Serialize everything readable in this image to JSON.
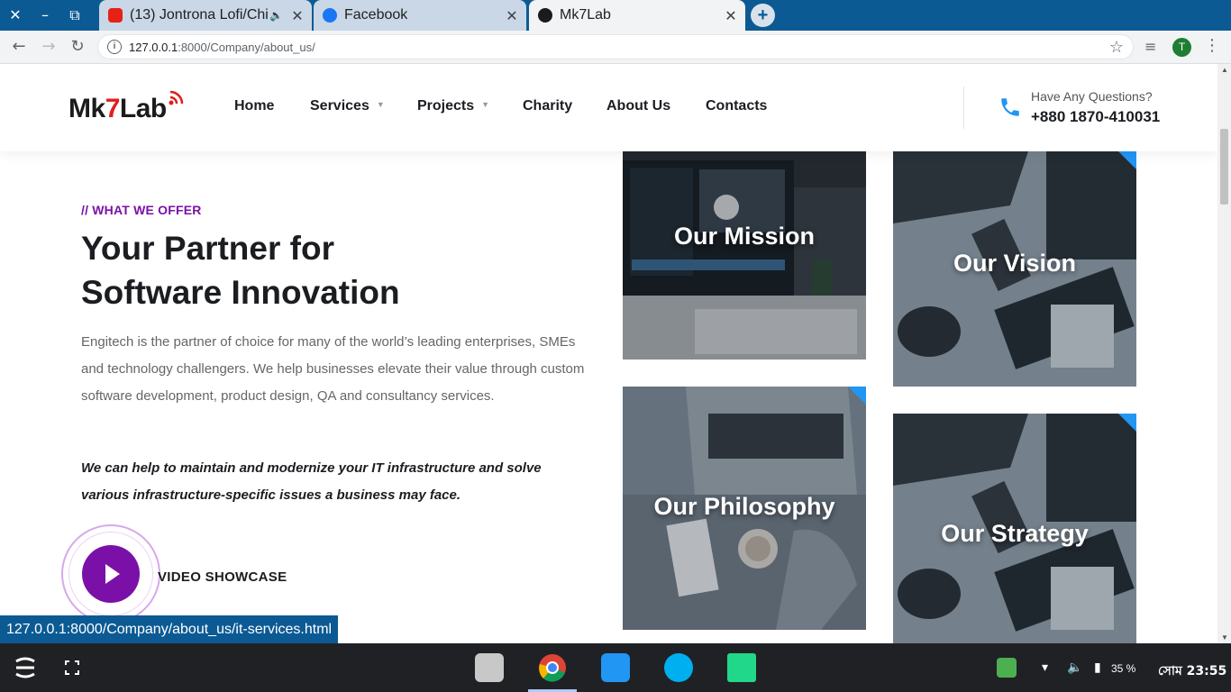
{
  "browser": {
    "tabs": [
      {
        "title": "(13) Jontrona Lofi/Chi",
        "favicon": "youtube-icon",
        "active": false
      },
      {
        "title": "Facebook",
        "favicon": "facebook-icon",
        "active": false
      },
      {
        "title": "Mk7Lab",
        "favicon": "mk7lab-icon",
        "active": true
      }
    ],
    "url_host": "127.0.0.1",
    "url_rest": ":8000/Company/about_us/",
    "profile_initial": "T"
  },
  "site": {
    "logo": {
      "prefix": "Mk",
      "seven": "7",
      "suffix": "Lab"
    },
    "nav": [
      {
        "label": "Home",
        "has_dropdown": false
      },
      {
        "label": "Services",
        "has_dropdown": true
      },
      {
        "label": "Projects",
        "has_dropdown": true
      },
      {
        "label": "Charity",
        "has_dropdown": false
      },
      {
        "label": "About Us",
        "has_dropdown": false
      },
      {
        "label": "Contacts",
        "has_dropdown": false
      }
    ],
    "contact": {
      "label": "Have Any Questions?",
      "phone": "+880 1870-410031"
    },
    "colors": {
      "accent": "#7b10a8",
      "corner": "#2196f3",
      "logo_seven": "#e11d1d"
    }
  },
  "content": {
    "eyebrow": "// WHAT WE OFFER",
    "headline_line1": "Your Partner for",
    "headline_line2": "Software Innovation",
    "paragraph": "Engitech is the partner of choice for many of the world’s leading enterprises, SMEs and technology challengers. We help businesses elevate their value through custom software development, product design, QA and consultancy services.",
    "emphasis": "We can help to maintain and modernize your IT infrastructure and solve various infrastructure-specific issues a business may face.",
    "video_label": "VIDEO SHOWCASE"
  },
  "cards": {
    "mission": "Our Mission",
    "vision": "Our Vision",
    "philosophy": "Our Philosophy",
    "strategy": "Our Strategy"
  },
  "status_url": "127.0.0.1:8000/Company/about_us/it-services.html",
  "taskbar": {
    "battery": "35 %",
    "clock": "সোম 23:55"
  }
}
